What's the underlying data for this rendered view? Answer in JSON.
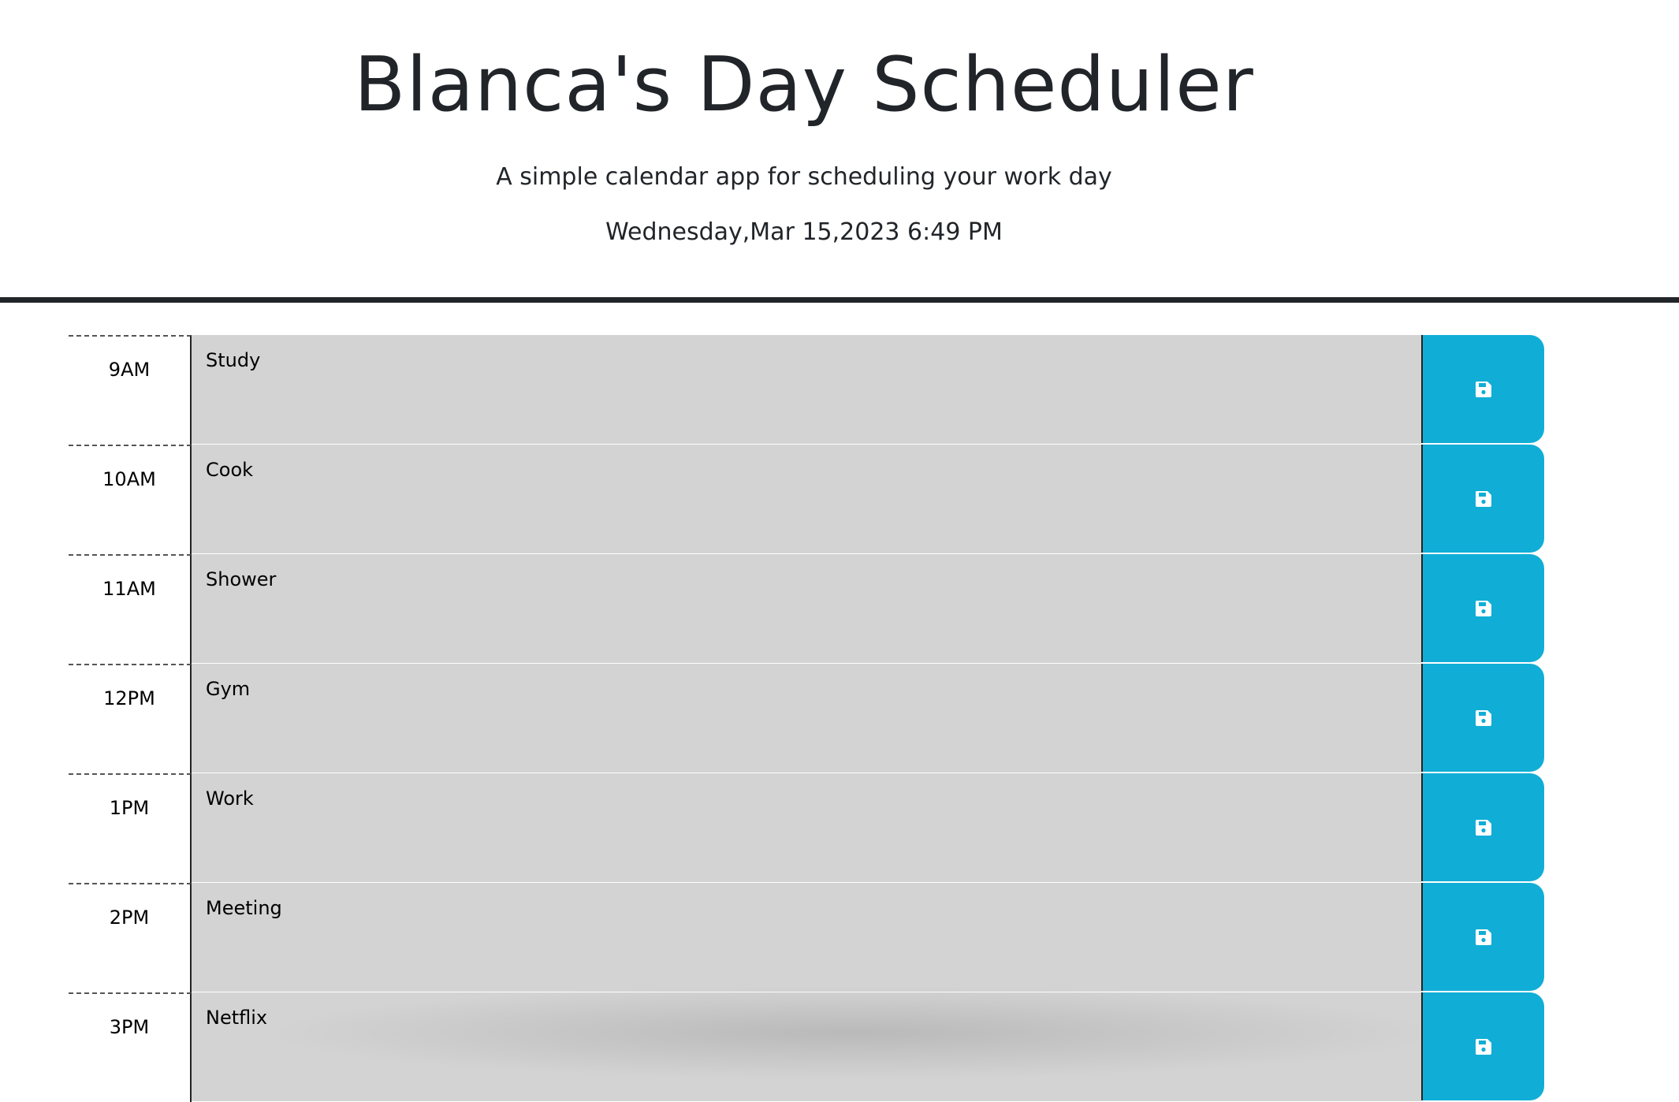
{
  "header": {
    "title": "Blanca's Day Scheduler",
    "subtitle": "A simple calendar app for scheduling your work day",
    "current_date": "Wednesday,Mar 15,2023 6:49 PM"
  },
  "colors": {
    "past_row": "#d3d3d3",
    "save_button": "#10aed6",
    "divider": "#212529"
  },
  "time_blocks": [
    {
      "hour": "9AM",
      "text": "Study",
      "save_icon": "floppy-disk-icon"
    },
    {
      "hour": "10AM",
      "text": "Cook",
      "save_icon": "floppy-disk-icon"
    },
    {
      "hour": "11AM",
      "text": "Shower",
      "save_icon": "floppy-disk-icon"
    },
    {
      "hour": "12PM",
      "text": "Gym",
      "save_icon": "floppy-disk-icon"
    },
    {
      "hour": "1PM",
      "text": "Work",
      "save_icon": "floppy-disk-icon"
    },
    {
      "hour": "2PM",
      "text": "Meeting",
      "save_icon": "floppy-disk-icon"
    },
    {
      "hour": "3PM",
      "text": "Netflix",
      "save_icon": "floppy-disk-icon"
    }
  ]
}
